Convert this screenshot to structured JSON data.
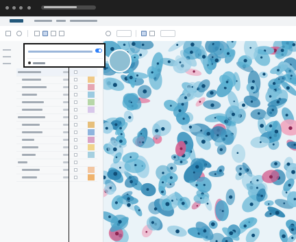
{
  "browser": {
    "url": ""
  },
  "app": {
    "breadcrumb": []
  },
  "popover": {
    "link": "",
    "toggle_on": true
  },
  "layers": [
    {
      "name": "",
      "count": "",
      "group": true,
      "color": ""
    },
    {
      "name": "",
      "count": "",
      "group": false,
      "color": "#f0c987"
    },
    {
      "name": "",
      "count": "",
      "group": false,
      "color": "#e6a6b2"
    },
    {
      "name": "",
      "count": "",
      "group": false,
      "color": "#9ccbe1"
    },
    {
      "name": "",
      "count": "",
      "group": false,
      "color": "#b7d7a8"
    },
    {
      "name": "",
      "count": "",
      "group": false,
      "color": "#d8c7ea"
    },
    {
      "name": "",
      "count": "",
      "group": true,
      "color": ""
    },
    {
      "name": "",
      "count": "",
      "group": false,
      "color": "#e7bf7b"
    },
    {
      "name": "",
      "count": "",
      "group": false,
      "color": "#8eb5de"
    },
    {
      "name": "",
      "count": "",
      "group": false,
      "color": "#d9a3c6"
    },
    {
      "name": "",
      "count": "",
      "group": false,
      "color": "#f1d48a"
    },
    {
      "name": "",
      "count": "",
      "group": false,
      "color": "#a6d0e0"
    },
    {
      "name": "",
      "count": "",
      "group": true,
      "color": ""
    },
    {
      "name": "",
      "count": "",
      "group": false,
      "color": "#f3c6a1"
    },
    {
      "name": "",
      "count": "",
      "group": false,
      "color": "#f0b36c"
    }
  ],
  "colors": {
    "accent": "#2d7ff9",
    "stain_blue": "#49a6cc",
    "stain_pink": "#e36c9c",
    "background_tissue": "#eaf3f8"
  },
  "icons": [
    "back-icon",
    "refresh-icon",
    "pan-icon",
    "select-icon",
    "draw-icon",
    "grid-icon",
    "zoom-icon",
    "measure-icon",
    "settings-icon"
  ]
}
